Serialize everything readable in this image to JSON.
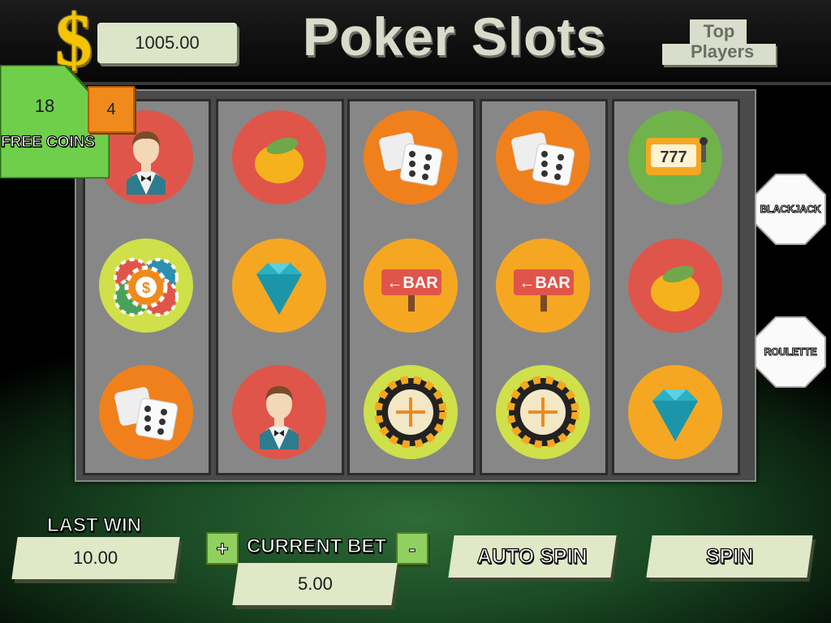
{
  "header": {
    "currency_symbol": "$",
    "balance": "1005.00",
    "title": "Poker Slots",
    "top_players_label": "Top Players"
  },
  "free_coins": {
    "count": "18",
    "label": "FREE COINS",
    "badge": "4"
  },
  "reels": [
    [
      "dealer",
      "chips",
      "dice"
    ],
    [
      "lemon",
      "diamond",
      "dealer"
    ],
    [
      "dice",
      "bar-sign",
      "roulette-wheel"
    ],
    [
      "dice",
      "bar-sign",
      "roulette-wheel"
    ],
    [
      "slot-machine-777",
      "lemon",
      "diamond"
    ]
  ],
  "symbol_text": {
    "bar": "BAR",
    "sevens": "777"
  },
  "side_buttons": {
    "blackjack": "BLACKJACK",
    "roulette": "ROULETTE"
  },
  "controls": {
    "last_win_label": "LAST WIN",
    "last_win_value": "10.00",
    "current_bet_label": "CURRENT BET",
    "current_bet_value": "5.00",
    "plus": "+",
    "minus": "-",
    "auto_spin": "AUTO SPIN",
    "spin": "SPIN"
  },
  "colors": {
    "green_panel": "#6fcf4a",
    "accent_orange": "#f08a1c",
    "coin_gold": "#f4c400"
  }
}
